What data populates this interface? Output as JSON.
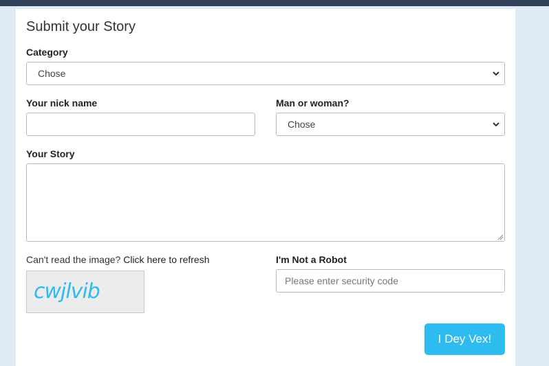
{
  "form": {
    "title": "Submit your Story",
    "category": {
      "label": "Category",
      "value": "Chose"
    },
    "nickname": {
      "label": "Your nick name",
      "value": ""
    },
    "gender": {
      "label": "Man or woman?",
      "value": "Chose"
    },
    "story": {
      "label": "Your Story",
      "value": ""
    },
    "captcha": {
      "prompt": "Can't read the image?",
      "refresh_link": "Click here to refresh",
      "image_text": "cwjlvib",
      "image_color": "#2ebcf0",
      "label": "I'm Not a Robot",
      "placeholder": "Please enter security code"
    },
    "submit_label": "I Dey Vex!"
  },
  "colors": {
    "background": "#deebf7",
    "topbar": "#2e4159",
    "accent": "#2ebcf0"
  }
}
